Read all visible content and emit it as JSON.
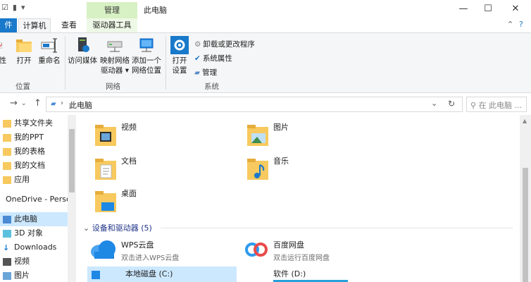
{
  "titlebar": {
    "context_tab": "管理",
    "title": "此电脑",
    "minimize": "—",
    "maximize": "☐",
    "close": "✕"
  },
  "tabs": {
    "file": "件",
    "computer": "计算机",
    "view": "查看",
    "drive_tools": "驱动器工具"
  },
  "ribbon": {
    "location_group": "位置",
    "network_group": "网络",
    "system_group": "系统",
    "btn_properties": "性",
    "btn_open": "打开",
    "btn_rename": "重命名",
    "btn_media_1": "访问媒体",
    "btn_map_1": "映射网络",
    "btn_map_2": "驱动器",
    "btn_addloc_1": "添加一个",
    "btn_addloc_2": "网络位置",
    "btn_settings_1": "打开",
    "btn_settings_2": "设置",
    "uninstall": "卸载或更改程序",
    "sys_props": "系统属性",
    "manage": "管理"
  },
  "address": {
    "crumb": "此电脑",
    "search_placeholder": "在 此电脑 ..."
  },
  "nav": {
    "items": [
      "共享文件夹",
      "我的PPT",
      "我的表格",
      "我的文档",
      "应用",
      "OneDrive - Perso",
      "此电脑",
      "3D 对象",
      "Downloads",
      "视频",
      "图片"
    ]
  },
  "folders": [
    "视频",
    "图片",
    "文档",
    "音乐",
    "桌面"
  ],
  "devices": {
    "header": "设备和驱动器 (5)",
    "wps": {
      "name": "WPS云盘",
      "sub": "双击进入WPS云盘"
    },
    "baidu": {
      "name": "百度网盘",
      "sub": "双击运行百度网盘"
    },
    "c_drive": {
      "name": "本地磁盘 (C:)"
    },
    "d_drive": {
      "name": "软件 (D:)"
    }
  },
  "colors": {
    "accent": "#1979ca",
    "context_tab": "#d7f0c4",
    "selection": "#cce8ff",
    "folder": "#f7c95e"
  }
}
